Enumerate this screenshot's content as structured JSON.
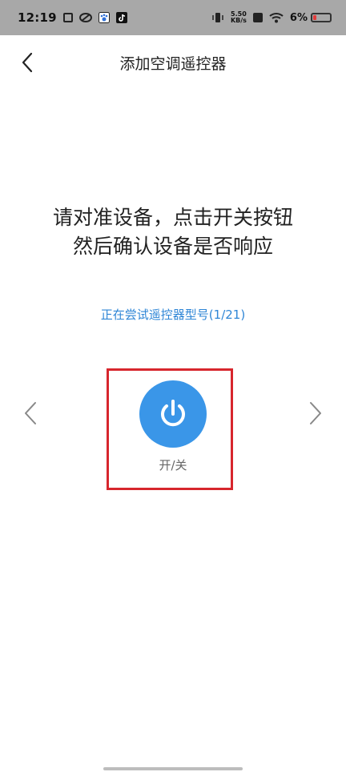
{
  "statusbar": {
    "time": "12:19",
    "net_speed_value": "5.50",
    "net_speed_unit": "KB/s",
    "battery_percent": "6%"
  },
  "header": {
    "title": "添加空调遥控器"
  },
  "instruction": {
    "line1": "请对准设备，点击开关按钮",
    "line2": "然后确认设备是否响应"
  },
  "status": {
    "text": "正在尝试遥控器型号(1/21)"
  },
  "power": {
    "label": "开/关"
  },
  "colors": {
    "accent": "#3a96e8",
    "status_text": "#2f86d6",
    "highlight": "#d7262d",
    "battery_low": "#e23b3b"
  },
  "icons": {
    "back": "chevron-left-icon",
    "prev": "chevron-left-icon",
    "next": "chevron-right-icon",
    "power": "power-icon"
  }
}
